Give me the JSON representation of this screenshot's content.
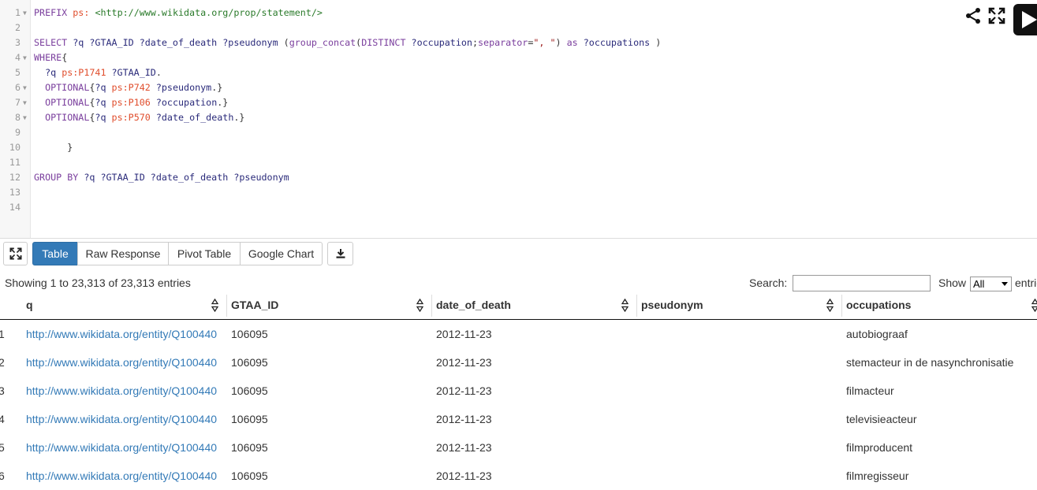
{
  "editor": {
    "lines": [
      {
        "num": "1",
        "fold": true,
        "tokens": [
          {
            "t": "PREFIX ",
            "c": "kw"
          },
          {
            "t": "ps:",
            "c": "pre"
          },
          {
            "t": " ",
            "c": "pl"
          },
          {
            "t": "<http://www.wikidata.org/prop/statement/>",
            "c": "iri"
          }
        ]
      },
      {
        "num": "2",
        "fold": false,
        "tokens": []
      },
      {
        "num": "3",
        "fold": false,
        "tokens": [
          {
            "t": "SELECT ",
            "c": "kw"
          },
          {
            "t": "?q ?GTAA_ID ?date_of_death ?pseudonym ",
            "c": "var"
          },
          {
            "t": "(",
            "c": "pl"
          },
          {
            "t": "group_concat",
            "c": "kw"
          },
          {
            "t": "(",
            "c": "pl"
          },
          {
            "t": "DISTINCT ",
            "c": "kw"
          },
          {
            "t": "?occupation",
            "c": "var"
          },
          {
            "t": ";",
            "c": "pl"
          },
          {
            "t": "separator",
            "c": "kw"
          },
          {
            "t": "=",
            "c": "pl"
          },
          {
            "t": "\", \"",
            "c": "str"
          },
          {
            "t": ") ",
            "c": "pl"
          },
          {
            "t": "as ",
            "c": "kw"
          },
          {
            "t": "?occupations ",
            "c": "var"
          },
          {
            "t": ")",
            "c": "pl"
          }
        ]
      },
      {
        "num": "4",
        "fold": true,
        "tokens": [
          {
            "t": "WHERE",
            "c": "kw"
          },
          {
            "t": "{",
            "c": "pl"
          }
        ]
      },
      {
        "num": "5",
        "fold": false,
        "tokens": [
          {
            "t": "  ?q ",
            "c": "var"
          },
          {
            "t": "ps:P1741",
            "c": "pre"
          },
          {
            "t": " ?GTAA_ID",
            "c": "var"
          },
          {
            "t": ".",
            "c": "pl"
          }
        ]
      },
      {
        "num": "6",
        "fold": true,
        "tokens": [
          {
            "t": "  OPTIONAL",
            "c": "kw"
          },
          {
            "t": "{",
            "c": "pl"
          },
          {
            "t": "?q ",
            "c": "var"
          },
          {
            "t": "ps:P742",
            "c": "pre"
          },
          {
            "t": " ?pseudonym",
            "c": "var"
          },
          {
            "t": ".}",
            "c": "pl"
          }
        ]
      },
      {
        "num": "7",
        "fold": true,
        "tokens": [
          {
            "t": "  OPTIONAL",
            "c": "kw"
          },
          {
            "t": "{",
            "c": "pl"
          },
          {
            "t": "?q ",
            "c": "var"
          },
          {
            "t": "ps:P106",
            "c": "pre"
          },
          {
            "t": " ?occupation",
            "c": "var"
          },
          {
            "t": ".}",
            "c": "pl"
          }
        ]
      },
      {
        "num": "8",
        "fold": true,
        "tokens": [
          {
            "t": "  OPTIONAL",
            "c": "kw"
          },
          {
            "t": "{",
            "c": "pl"
          },
          {
            "t": "?q ",
            "c": "var"
          },
          {
            "t": "ps:P570",
            "c": "pre"
          },
          {
            "t": " ?date_of_death",
            "c": "var"
          },
          {
            "t": ".}",
            "c": "pl"
          }
        ]
      },
      {
        "num": "9",
        "fold": false,
        "tokens": []
      },
      {
        "num": "10",
        "fold": false,
        "tokens": [
          {
            "t": "      }",
            "c": "pl"
          }
        ]
      },
      {
        "num": "11",
        "fold": false,
        "tokens": []
      },
      {
        "num": "12",
        "fold": false,
        "tokens": [
          {
            "t": "GROUP BY ",
            "c": "kw"
          },
          {
            "t": "?q ?GTAA_ID ?date_of_death ?pseudonym",
            "c": "var"
          }
        ]
      },
      {
        "num": "13",
        "fold": false,
        "tokens": []
      },
      {
        "num": "14",
        "fold": false,
        "tokens": []
      }
    ]
  },
  "icons": {
    "share": "share-icon",
    "expand": "expand-icon",
    "run": "play-icon",
    "download": "download-icon"
  },
  "toolbar": {
    "tabs": [
      "Table",
      "Raw Response",
      "Pivot Table",
      "Google Chart"
    ],
    "active_tab": "Table"
  },
  "info": {
    "showing": "Showing 1 to 23,313 of 23,313 entries",
    "search_label": "Search:",
    "search_value": "",
    "show_label": "Show",
    "show_value": "All",
    "entries_label": "entries"
  },
  "table": {
    "headers": [
      "q",
      "GTAA_ID",
      "date_of_death",
      "pseudonym",
      "occupations"
    ],
    "rows": [
      {
        "n": "1",
        "q": "http://www.wikidata.org/entity/Q100440",
        "gtaa": "106095",
        "dod": "2012-11-23",
        "pseudonym": "",
        "occupations": "autobiograaf"
      },
      {
        "n": "2",
        "q": "http://www.wikidata.org/entity/Q100440",
        "gtaa": "106095",
        "dod": "2012-11-23",
        "pseudonym": "",
        "occupations": "stemacteur in de nasynchronisatie"
      },
      {
        "n": "3",
        "q": "http://www.wikidata.org/entity/Q100440",
        "gtaa": "106095",
        "dod": "2012-11-23",
        "pseudonym": "",
        "occupations": "filmacteur"
      },
      {
        "n": "4",
        "q": "http://www.wikidata.org/entity/Q100440",
        "gtaa": "106095",
        "dod": "2012-11-23",
        "pseudonym": "",
        "occupations": "televisieacteur"
      },
      {
        "n": "5",
        "q": "http://www.wikidata.org/entity/Q100440",
        "gtaa": "106095",
        "dod": "2012-11-23",
        "pseudonym": "",
        "occupations": "filmproducent"
      },
      {
        "n": "6",
        "q": "http://www.wikidata.org/entity/Q100440",
        "gtaa": "106095",
        "dod": "2012-11-23",
        "pseudonym": "",
        "occupations": "filmregisseur"
      }
    ]
  },
  "colors": {
    "accent": "#337ab7",
    "link": "#337ab7"
  }
}
